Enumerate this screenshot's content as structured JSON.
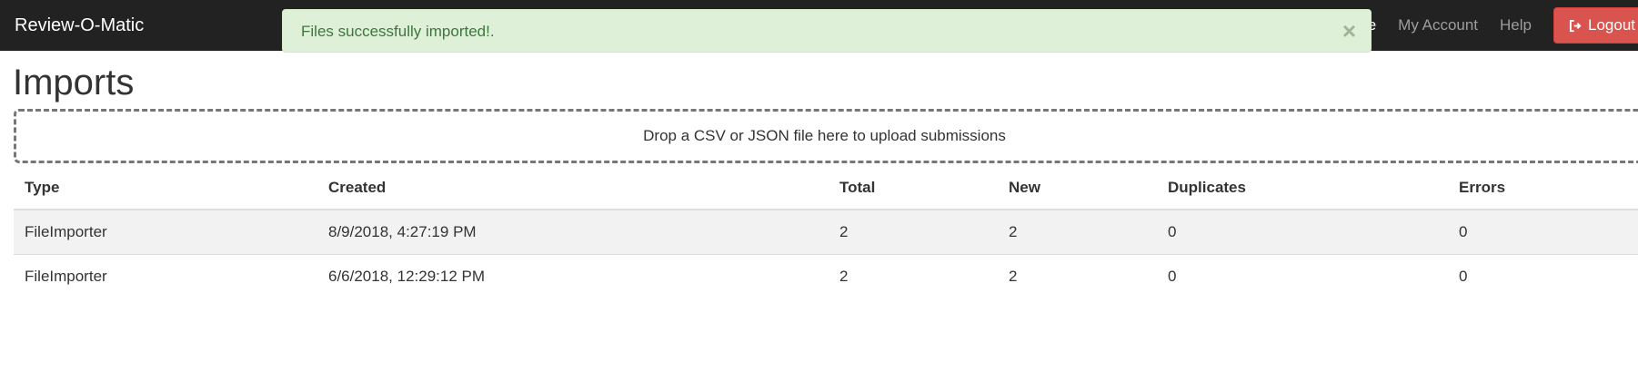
{
  "navbar": {
    "brand": "Review-O-Matic",
    "links": [
      {
        "label": "ueue"
      },
      {
        "label": "My Account"
      },
      {
        "label": "Help"
      }
    ],
    "logout_label": "Logout",
    "logout_icon": "sign-out-icon",
    "background": "#222222",
    "logout_color": "#d9534f"
  },
  "alert": {
    "message": "Files successfully imported!.",
    "close": "×",
    "background": "#dff0d8",
    "text_color": "#3c763d"
  },
  "page": {
    "title": "Imports"
  },
  "dropzone": {
    "text": "Drop a CSV or JSON file here to upload submissions"
  },
  "table": {
    "headers": [
      "Type",
      "Created",
      "Total",
      "New",
      "Duplicates",
      "Errors"
    ],
    "rows": [
      [
        "FileImporter",
        "8/9/2018, 4:27:19 PM",
        "2",
        "2",
        "0",
        "0"
      ],
      [
        "FileImporter",
        "6/6/2018, 12:29:12 PM",
        "2",
        "2",
        "0",
        "0"
      ]
    ]
  }
}
